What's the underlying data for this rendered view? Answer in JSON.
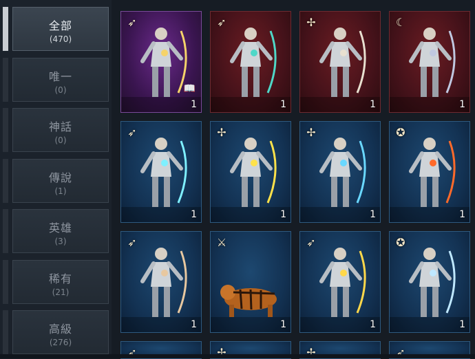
{
  "categories": [
    {
      "name": "全部",
      "count": "(470)",
      "active": true
    },
    {
      "name": "唯一",
      "count": "(0)",
      "active": false
    },
    {
      "name": "神話",
      "count": "(0)",
      "active": false
    },
    {
      "name": "傳說",
      "count": "(1)",
      "active": false
    },
    {
      "name": "英雄",
      "count": "(3)",
      "active": false
    },
    {
      "name": "稀有",
      "count": "(21)",
      "active": false
    },
    {
      "name": "高級",
      "count": "(276)",
      "active": false
    }
  ],
  "cards": [
    {
      "rarity": "purple",
      "class_icon": "bow-icon",
      "qty": "1",
      "has_book": true,
      "figure": "archer-gold",
      "accent": "#f5d36a"
    },
    {
      "rarity": "red",
      "class_icon": "bow-icon",
      "qty": "1",
      "has_book": false,
      "figure": "archer-teal",
      "accent": "#4fd8c8"
    },
    {
      "rarity": "red",
      "class_icon": "spear-icon",
      "qty": "1",
      "has_book": false,
      "figure": "spearman-white",
      "accent": "#e8e0d0"
    },
    {
      "rarity": "red",
      "class_icon": "scythe-icon",
      "qty": "1",
      "has_book": false,
      "figure": "reaper-dark",
      "accent": "#c0c8e0"
    },
    {
      "rarity": "blue",
      "class_icon": "bow-icon",
      "qty": "1",
      "has_book": false,
      "figure": "archer-white",
      "accent": "#7ff0ff"
    },
    {
      "rarity": "blue",
      "class_icon": "spear-icon",
      "qty": "1",
      "has_book": false,
      "figure": "knight-armored",
      "accent": "#ffe24a"
    },
    {
      "rarity": "blue",
      "class_icon": "spear-icon",
      "qty": "1",
      "has_book": false,
      "figure": "lancer-runner",
      "accent": "#6ad8ff"
    },
    {
      "rarity": "blue",
      "class_icon": "beast-icon",
      "qty": "1",
      "has_book": false,
      "figure": "demon-red",
      "accent": "#ff6a2a"
    },
    {
      "rarity": "blue",
      "class_icon": "bow-icon",
      "qty": "1",
      "has_book": false,
      "figure": "archer-tan",
      "accent": "#e8c8a0"
    },
    {
      "rarity": "blue",
      "class_icon": "claw-icon",
      "qty": "1",
      "has_book": false,
      "figure": "tiger",
      "accent": "#e08a2a"
    },
    {
      "rarity": "blue",
      "class_icon": "bow-icon",
      "qty": "1",
      "has_book": false,
      "figure": "cloaked-archer",
      "accent": "#ffd84a"
    },
    {
      "rarity": "blue",
      "class_icon": "beast-icon",
      "qty": "1",
      "has_book": false,
      "figure": "skeleton-lancer",
      "accent": "#bfe8ff"
    }
  ],
  "partial_row_icons": [
    "bow-icon",
    "spear-icon",
    "spear-icon",
    "bow-icon"
  ]
}
